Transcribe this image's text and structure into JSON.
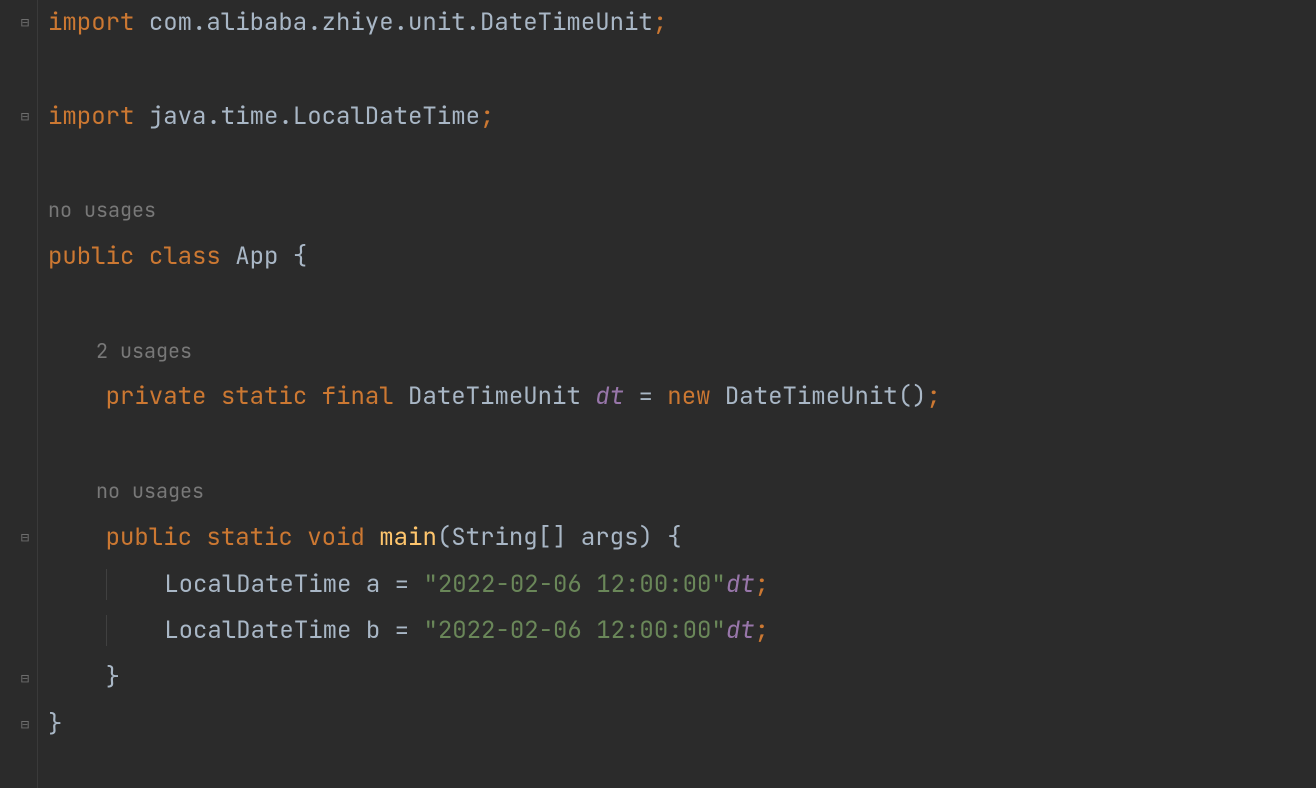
{
  "code": {
    "import1_kw": "import",
    "import1_target": "com.alibaba.zhiye.unit.DateTimeUnit",
    "import2_kw": "import",
    "import2_target": "java.time.LocalDateTime",
    "class_hint": "no usages",
    "class_public": "public",
    "class_class": "class",
    "class_name": "App",
    "field_hint": "2 usages",
    "field_private": "private",
    "field_static": "static",
    "field_final": "final",
    "field_type": "DateTimeUnit",
    "field_name": "dt",
    "field_eq": "=",
    "field_new": "new",
    "field_ctor": "DateTimeUnit",
    "method_hint": "no usages",
    "method_public": "public",
    "method_static": "static",
    "method_void": "void",
    "method_name": "main",
    "method_param_type": "String[]",
    "method_param_name": "args",
    "local_a_type": "LocalDateTime",
    "local_a_name": "a",
    "local_a_str": "\"2022-02-06 12:00:00\"",
    "local_a_suffix": "dt",
    "local_b_type": "LocalDateTime",
    "local_b_name": "b",
    "local_b_str": "\"2022-02-06 12:00:00\"",
    "local_b_suffix": "dt",
    "semi": ";",
    "lbrace": "{",
    "rbrace": "}",
    "lparen": "(",
    "rparen": ")",
    "empty_ctor": "()"
  },
  "fold": {
    "minus": "⊟",
    "end": "⊟"
  }
}
